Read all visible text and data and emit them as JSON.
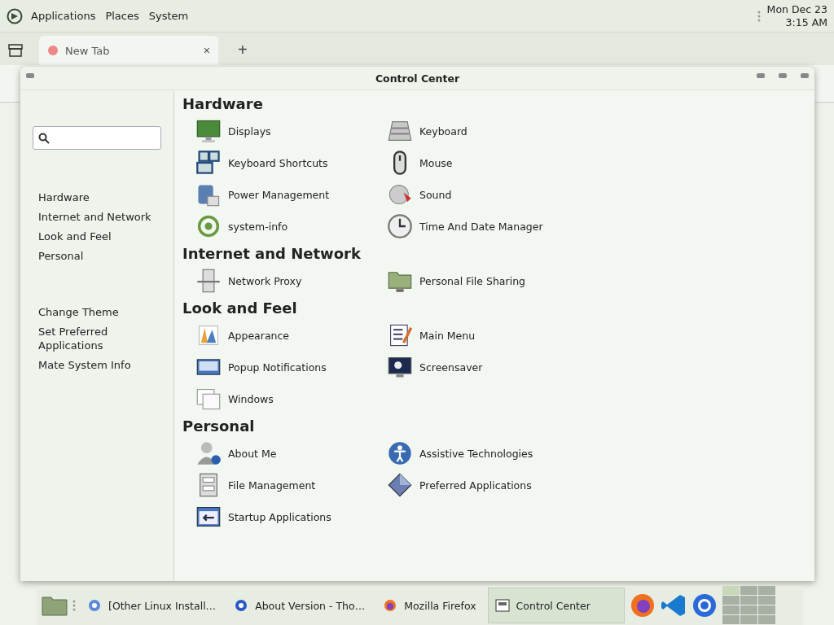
{
  "top_panel": {
    "menu": [
      "Applications",
      "Places",
      "System"
    ],
    "clock": {
      "date": "Mon Dec 23",
      "time": "3:15 AM"
    }
  },
  "browser": {
    "tab": {
      "label": "New Tab",
      "close": "×"
    },
    "new_tab": "+"
  },
  "window": {
    "title": "Control Center",
    "sidebar": {
      "categories": [
        "Hardware",
        "Internet and Network",
        "Look and Feel",
        "Personal"
      ],
      "actions": [
        "Change Theme",
        "Set Preferred Applications",
        "Mate System Info"
      ]
    },
    "sections": [
      {
        "title": "Hardware",
        "items": [
          {
            "label": "Displays"
          },
          {
            "label": "Keyboard"
          },
          {
            "label": "Keyboard Shortcuts"
          },
          {
            "label": "Mouse"
          },
          {
            "label": "Power Management"
          },
          {
            "label": "Sound"
          },
          {
            "label": "system-info"
          },
          {
            "label": "Time And Date Manager"
          }
        ]
      },
      {
        "title": "Internet and Network",
        "items": [
          {
            "label": "Network Proxy"
          },
          {
            "label": "Personal File Sharing"
          }
        ]
      },
      {
        "title": "Look and Feel",
        "items": [
          {
            "label": "Appearance"
          },
          {
            "label": "Main Menu"
          },
          {
            "label": "Popup Notifications"
          },
          {
            "label": "Screensaver"
          },
          {
            "label": "Windows"
          }
        ]
      },
      {
        "title": "Personal",
        "items": [
          {
            "label": "About Me"
          },
          {
            "label": "Assistive Technologies"
          },
          {
            "label": "File Management"
          },
          {
            "label": "Preferred Applications"
          },
          {
            "label": "Startup Applications"
          }
        ]
      }
    ]
  },
  "taskbar": {
    "tasks": [
      {
        "label": "[Other Linux Install…",
        "selected": false
      },
      {
        "label": "About Version - Tho…",
        "selected": false
      },
      {
        "label": "Mozilla Firefox",
        "selected": false
      },
      {
        "label": "Control Center",
        "selected": true
      }
    ]
  }
}
